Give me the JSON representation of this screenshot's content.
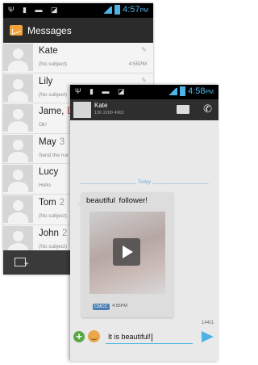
{
  "list_screen": {
    "status": {
      "time": "4:57",
      "ampm": "PM"
    },
    "title": "Messages",
    "threads": [
      {
        "name": "Kate",
        "count": "",
        "subject": "(No subject)",
        "time": "4:55PM",
        "clip": true
      },
      {
        "name": "Lily",
        "count": "",
        "subject": "(No subject)",
        "time": "",
        "clip": true
      },
      {
        "name": "Jame,",
        "count": "D",
        "subject": "Ok!",
        "time": "",
        "clip": false
      },
      {
        "name": "May",
        "count": "3",
        "subject": "Send the nor",
        "time": "",
        "clip": false
      },
      {
        "name": "Lucy",
        "count": "",
        "subject": "Hello",
        "time": "",
        "clip": false
      },
      {
        "name": "Tom",
        "count": "2",
        "subject": "(No subject)",
        "time": "",
        "clip": false
      },
      {
        "name": "John",
        "count": "2",
        "subject": "(No subject)",
        "time": "",
        "clip": false
      }
    ]
  },
  "conversation_screen": {
    "status": {
      "time": "4:58",
      "ampm": "PM"
    },
    "contact_name": "Kate",
    "contact_number": "136 2200 4962",
    "date_separator": "Today",
    "message": {
      "text": "beautiful  follower!",
      "carrier": "CMCC",
      "time": "4:55PM"
    },
    "char_counter": "144/1",
    "compose_value": "It is beautiful!"
  },
  "colors": {
    "accent": "#4fb3e6",
    "app_icon": "#f0a23b",
    "add_button": "#5aa845"
  }
}
